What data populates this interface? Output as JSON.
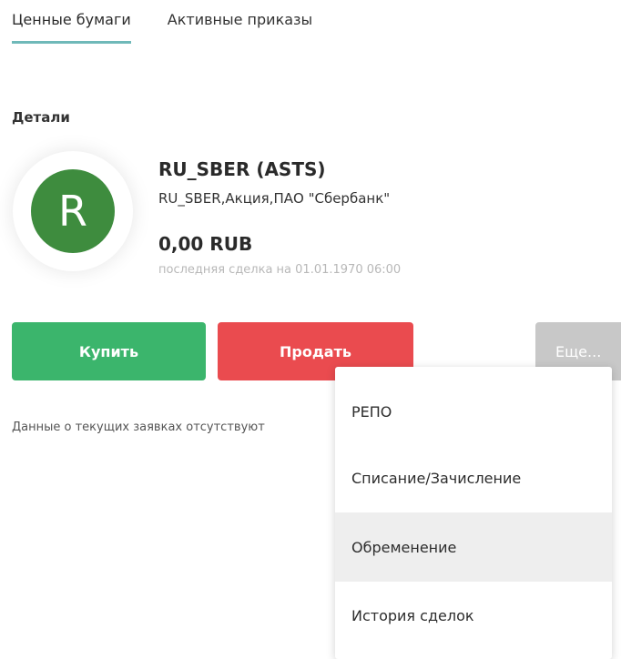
{
  "tabs": [
    {
      "label": "Ценные бумаги",
      "active": true
    },
    {
      "label": "Активные приказы",
      "active": false
    }
  ],
  "details": {
    "section_label": "Детали",
    "avatar_letter": "R",
    "avatar_color": "#3e8c3e",
    "title": "RU_SBER  (ASTS)",
    "subtitle": "RU_SBER,Акция,ПАО \"Сбербанк\"",
    "price": "0,00  RUB",
    "last_trade": "последняя сделка на 01.01.1970 06:00"
  },
  "actions": {
    "buy_label": "Купить",
    "buy_color": "#3bb56c",
    "sell_label": "Продать",
    "sell_color": "#ea4b4f",
    "more_label": "Еще...",
    "more_color": "#c8c8c8"
  },
  "orders": {
    "empty_text": "Данные о текущих заявках отсутствуют"
  },
  "more_menu": {
    "items": [
      {
        "label": "РЕПО"
      },
      {
        "label": "Списание/Зачисление"
      },
      {
        "label": "Обременение",
        "highlighted": true
      },
      {
        "label": "История сделок"
      }
    ]
  }
}
